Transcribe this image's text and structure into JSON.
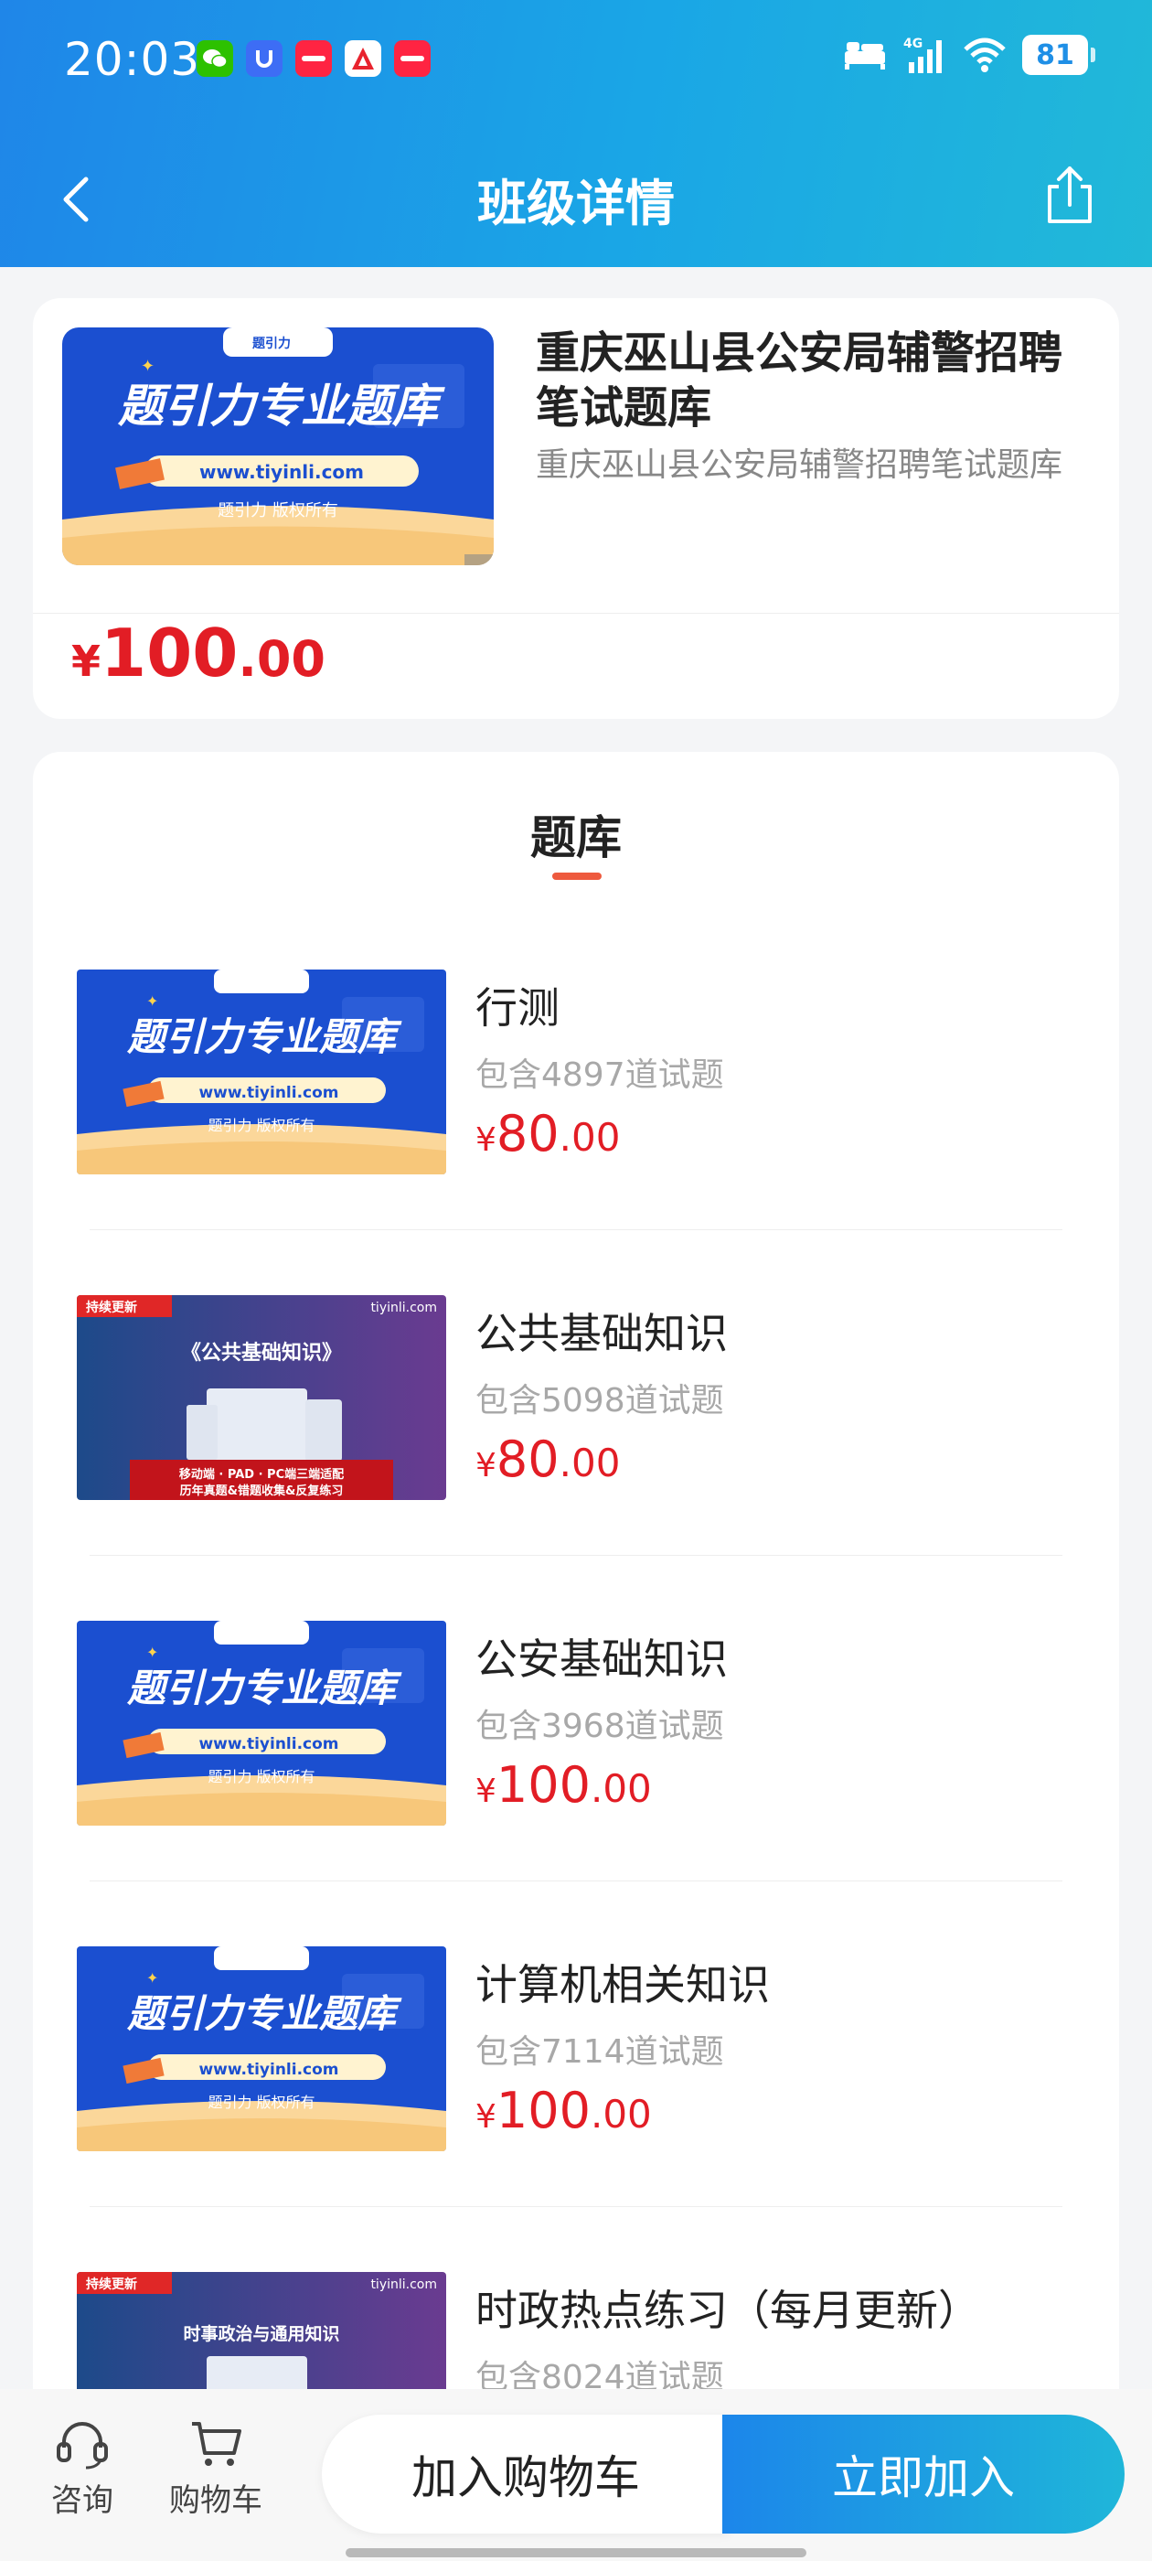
{
  "status_bar": {
    "time": "20:03",
    "notification_icons": [
      "wechat-icon",
      "u-app-icon",
      "xiaohongshu-icon",
      "a-app-icon",
      "xiaohongshu-icon"
    ],
    "network": "4G",
    "battery": "81"
  },
  "nav": {
    "title": "班级详情"
  },
  "product": {
    "name": "重庆巫山县公安局辅警招聘笔试题库",
    "description": "重庆巫山县公安局辅警招聘笔试题库",
    "price_symbol": "¥",
    "price_int": "100",
    "price_dec": ".00",
    "cover": {
      "title": "题引力专业题库",
      "url": "www.tiyinli.com",
      "copyright": "题引力 版权所有",
      "brand": "题引力"
    }
  },
  "bank_section": {
    "title": "题库",
    "items": [
      {
        "name": "行测",
        "count": "包含4897道试题",
        "price_symbol": "¥",
        "price_int": "80",
        "price_dec": ".00",
        "cover_type": "blue",
        "cover_title": "题引力专业题库",
        "cover_url": "www.tiyinli.com",
        "cover_copyright": "题引力 版权所有"
      },
      {
        "name": "公共基础知识",
        "count": "包含5098道试题",
        "price_symbol": "¥",
        "price_int": "80",
        "price_dec": ".00",
        "cover_type": "purple",
        "cover_badge": "持续更新",
        "cover_site": "tiyinli.com",
        "cover_title": "《公共基础知识》",
        "cover_line1": "移动端 · PAD · PC端三端适配",
        "cover_line2": "历年真题&错题收集&反复练习"
      },
      {
        "name": "公安基础知识",
        "count": "包含3968道试题",
        "price_symbol": "¥",
        "price_int": "100",
        "price_dec": ".00",
        "cover_type": "blue",
        "cover_title": "题引力专业题库",
        "cover_url": "www.tiyinli.com",
        "cover_copyright": "题引力 版权所有"
      },
      {
        "name": "计算机相关知识",
        "count": "包含7114道试题",
        "price_symbol": "¥",
        "price_int": "100",
        "price_dec": ".00",
        "cover_type": "blue",
        "cover_title": "题引力专业题库",
        "cover_url": "www.tiyinli.com",
        "cover_copyright": "题引力 版权所有"
      },
      {
        "name": "时政热点练习（每月更新）",
        "count": "包含8024道试题",
        "cover_type": "purple",
        "cover_badge": "持续更新",
        "cover_site": "tiyinli.com",
        "cover_title": "时事政治与通用知识"
      }
    ]
  },
  "bottom_bar": {
    "consult_label": "咨询",
    "cart_label": "购物车",
    "add_cart_button": "加入购物车",
    "join_button": "立即加入"
  },
  "colors": {
    "header_gradient_start": "#1f86e8",
    "header_gradient_end": "#21b9d8",
    "price_red": "#e21d25",
    "tab_underline": "#ee5a3e",
    "cover_blue": "#1b4fd0",
    "cover_purple": "#5b3a8c"
  }
}
